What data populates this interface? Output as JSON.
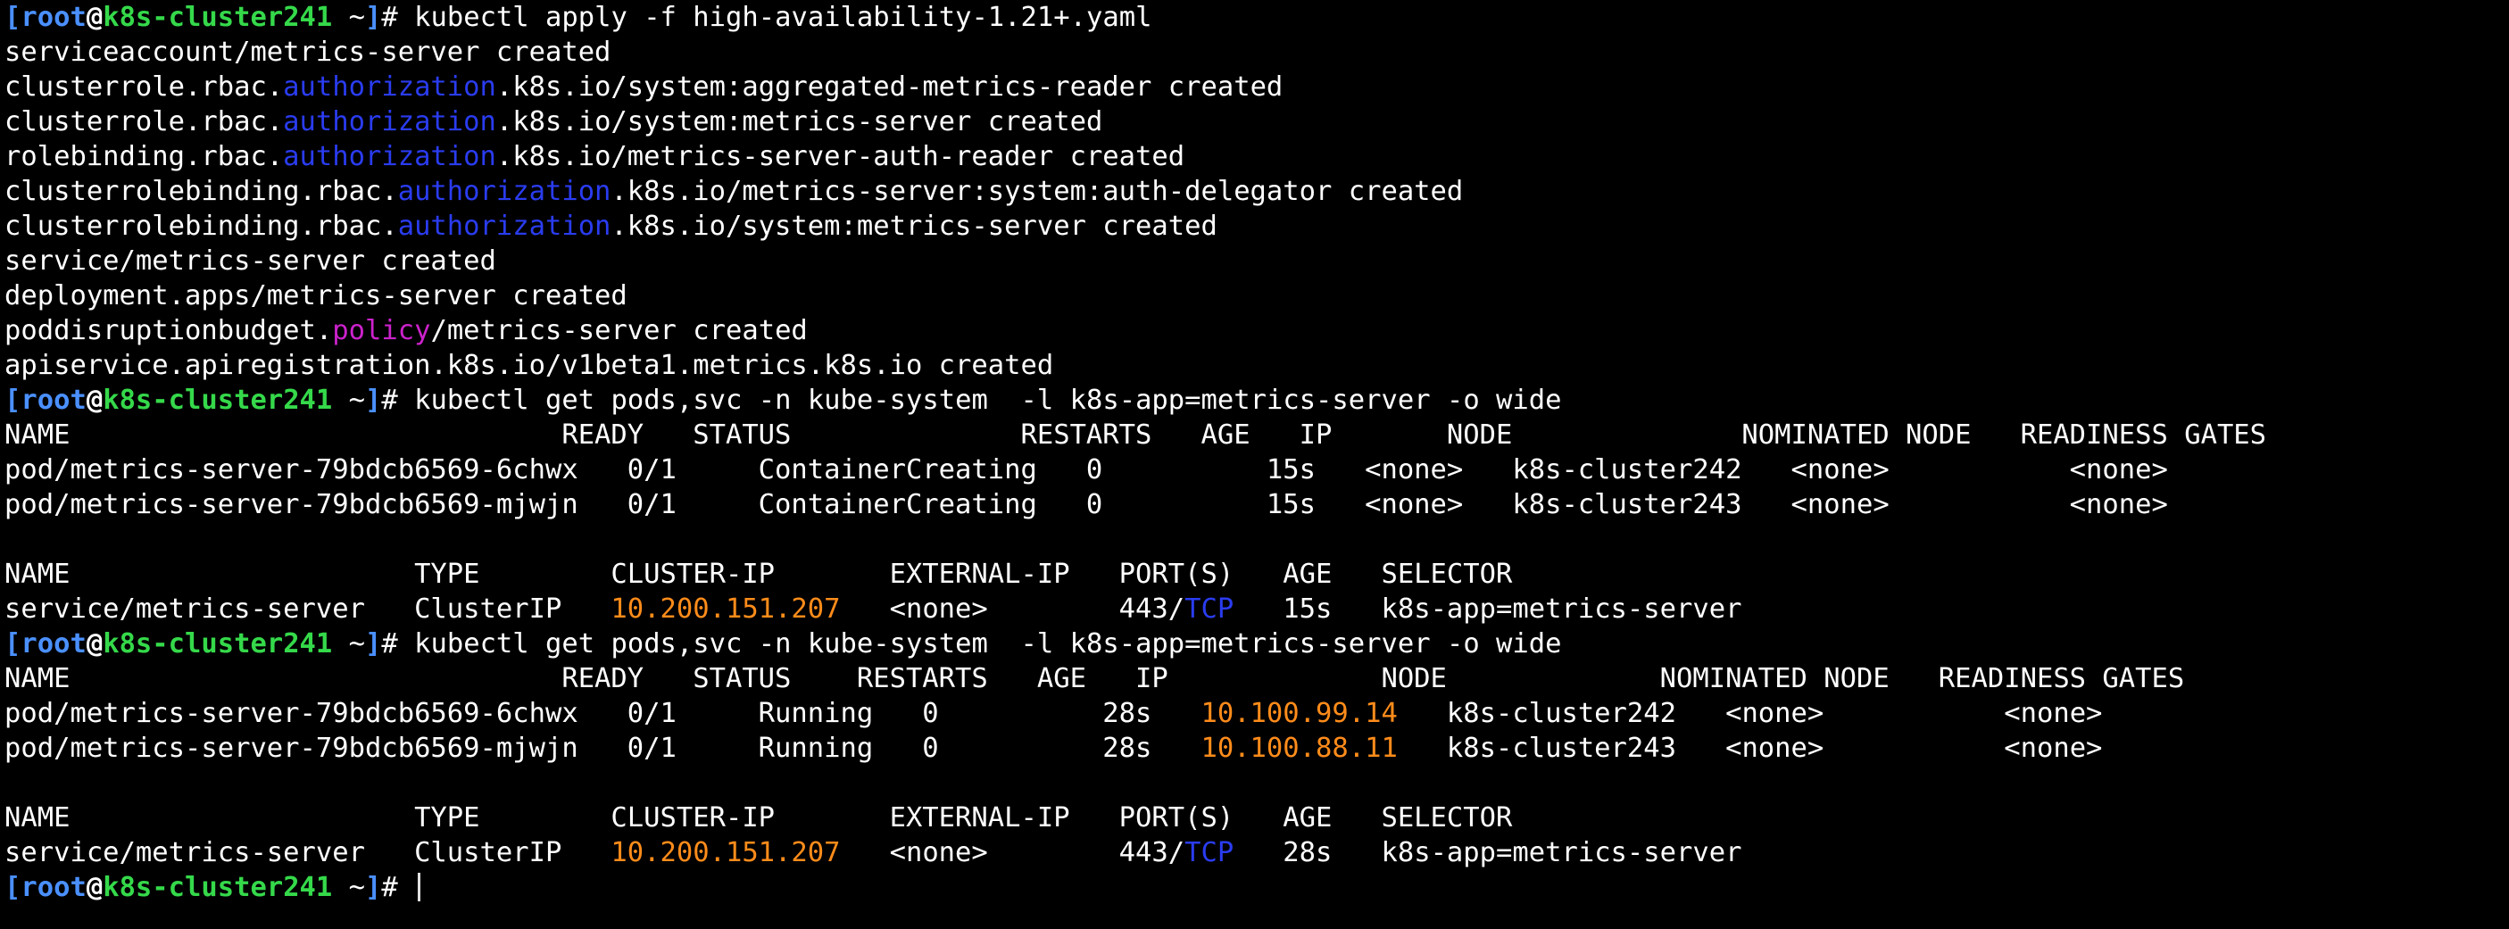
{
  "colors": {
    "text": "#ffffff",
    "bracket": "#4a90ff",
    "user": "#4a90ff",
    "at": "#ffffff",
    "host": "#35d94a",
    "api_group": "#2a3cf0",
    "policy": "#cc22cc",
    "ip": "#ff8c1a",
    "protocol": "#2a3cf0",
    "background": "#000000"
  },
  "terminal": {
    "lines": [
      {
        "segments": [
          {
            "text": "[",
            "role": "bracket"
          },
          {
            "text": "root",
            "role": "user"
          },
          {
            "text": "@",
            "role": "at"
          },
          {
            "text": "k8s-cluster241",
            "role": "host"
          },
          {
            "text": " ~",
            "role": "text"
          },
          {
            "text": "]",
            "role": "bracket"
          },
          {
            "text": "# kubectl apply -f high-availability-1.21+.yaml",
            "role": "text"
          }
        ]
      },
      {
        "segments": [
          {
            "text": "serviceaccount/metrics-server created",
            "role": "text"
          }
        ]
      },
      {
        "segments": [
          {
            "text": "clusterrole.rbac.",
            "role": "text"
          },
          {
            "text": "authorization",
            "role": "api_group"
          },
          {
            "text": ".k8s.io/system:aggregated-metrics-reader created",
            "role": "text"
          }
        ]
      },
      {
        "segments": [
          {
            "text": "clusterrole.rbac.",
            "role": "text"
          },
          {
            "text": "authorization",
            "role": "api_group"
          },
          {
            "text": ".k8s.io/system:metrics-server created",
            "role": "text"
          }
        ]
      },
      {
        "segments": [
          {
            "text": "rolebinding.rbac.",
            "role": "text"
          },
          {
            "text": "authorization",
            "role": "api_group"
          },
          {
            "text": ".k8s.io/metrics-server-auth-reader created",
            "role": "text"
          }
        ]
      },
      {
        "segments": [
          {
            "text": "clusterrolebinding.rbac.",
            "role": "text"
          },
          {
            "text": "authorization",
            "role": "api_group"
          },
          {
            "text": ".k8s.io/metrics-server:system:auth-delegator created",
            "role": "text"
          }
        ]
      },
      {
        "segments": [
          {
            "text": "clusterrolebinding.rbac.",
            "role": "text"
          },
          {
            "text": "authorization",
            "role": "api_group"
          },
          {
            "text": ".k8s.io/system:metrics-server created",
            "role": "text"
          }
        ]
      },
      {
        "segments": [
          {
            "text": "service/metrics-server created",
            "role": "text"
          }
        ]
      },
      {
        "segments": [
          {
            "text": "deployment.apps/metrics-server created",
            "role": "text"
          }
        ]
      },
      {
        "segments": [
          {
            "text": "poddisruptionbudget.",
            "role": "text"
          },
          {
            "text": "policy",
            "role": "policy"
          },
          {
            "text": "/metrics-server created",
            "role": "text"
          }
        ]
      },
      {
        "segments": [
          {
            "text": "apiservice.apiregistration.k8s.io/v1beta1.metrics.k8s.io created",
            "role": "text"
          }
        ]
      },
      {
        "segments": [
          {
            "text": "[",
            "role": "bracket"
          },
          {
            "text": "root",
            "role": "user"
          },
          {
            "text": "@",
            "role": "at"
          },
          {
            "text": "k8s-cluster241",
            "role": "host"
          },
          {
            "text": " ~",
            "role": "text"
          },
          {
            "text": "]",
            "role": "bracket"
          },
          {
            "text": "# kubectl get pods,svc -n kube-system  -l k8s-app=metrics-server -o wide",
            "role": "text"
          }
        ]
      },
      {
        "segments": [
          {
            "text": "NAME                              READY   STATUS              RESTARTS   AGE   IP       NODE              NOMINATED NODE   READINESS GATES",
            "role": "text"
          }
        ]
      },
      {
        "segments": [
          {
            "text": "pod/metrics-server-79bdcb6569-6chwx   0/1     ContainerCreating   0          15s   <none>   k8s-cluster242   <none>           <none>",
            "role": "text"
          }
        ]
      },
      {
        "segments": [
          {
            "text": "pod/metrics-server-79bdcb6569-mjwjn   0/1     ContainerCreating   0          15s   <none>   k8s-cluster243   <none>           <none>",
            "role": "text"
          }
        ]
      },
      {
        "segments": [
          {
            "text": "",
            "role": "text"
          }
        ]
      },
      {
        "segments": [
          {
            "text": "NAME                     TYPE        CLUSTER-IP       EXTERNAL-IP   PORT(S)   AGE   SELECTOR",
            "role": "text"
          }
        ]
      },
      {
        "segments": [
          {
            "text": "service/metrics-server   ClusterIP   ",
            "role": "text"
          },
          {
            "text": "10.200.151.207",
            "role": "ip"
          },
          {
            "text": "   <none>        443/",
            "role": "text"
          },
          {
            "text": "TCP",
            "role": "protocol"
          },
          {
            "text": "   15s   k8s-app=metrics-server",
            "role": "text"
          }
        ]
      },
      {
        "segments": [
          {
            "text": "[",
            "role": "bracket"
          },
          {
            "text": "root",
            "role": "user"
          },
          {
            "text": "@",
            "role": "at"
          },
          {
            "text": "k8s-cluster241",
            "role": "host"
          },
          {
            "text": " ~",
            "role": "text"
          },
          {
            "text": "]",
            "role": "bracket"
          },
          {
            "text": "# kubectl get pods,svc -n kube-system  -l k8s-app=metrics-server -o wide",
            "role": "text"
          }
        ]
      },
      {
        "segments": [
          {
            "text": "NAME                              READY   STATUS    RESTARTS   AGE   IP             NODE             NOMINATED NODE   READINESS GATES",
            "role": "text"
          }
        ]
      },
      {
        "segments": [
          {
            "text": "pod/metrics-server-79bdcb6569-6chwx   0/1     Running   0          28s   ",
            "role": "text"
          },
          {
            "text": "10.100.99.14",
            "role": "ip"
          },
          {
            "text": "   k8s-cluster242   <none>           <none>",
            "role": "text"
          }
        ]
      },
      {
        "segments": [
          {
            "text": "pod/metrics-server-79bdcb6569-mjwjn   0/1     Running   0          28s   ",
            "role": "text"
          },
          {
            "text": "10.100.88.11",
            "role": "ip"
          },
          {
            "text": "   k8s-cluster243   <none>           <none>",
            "role": "text"
          }
        ]
      },
      {
        "segments": [
          {
            "text": "",
            "role": "text"
          }
        ]
      },
      {
        "segments": [
          {
            "text": "NAME                     TYPE        CLUSTER-IP       EXTERNAL-IP   PORT(S)   AGE   SELECTOR",
            "role": "text"
          }
        ]
      },
      {
        "segments": [
          {
            "text": "service/metrics-server   ClusterIP   ",
            "role": "text"
          },
          {
            "text": "10.200.151.207",
            "role": "ip"
          },
          {
            "text": "   <none>        443/",
            "role": "text"
          },
          {
            "text": "TCP",
            "role": "protocol"
          },
          {
            "text": "   28s   k8s-app=metrics-server",
            "role": "text"
          }
        ]
      },
      {
        "segments": [
          {
            "text": "[",
            "role": "bracket"
          },
          {
            "text": "root",
            "role": "user"
          },
          {
            "text": "@",
            "role": "at"
          },
          {
            "text": "k8s-cluster241",
            "role": "host"
          },
          {
            "text": " ~",
            "role": "text"
          },
          {
            "text": "]",
            "role": "bracket"
          },
          {
            "text": "# ",
            "role": "text"
          }
        ],
        "cursor": true
      }
    ]
  }
}
